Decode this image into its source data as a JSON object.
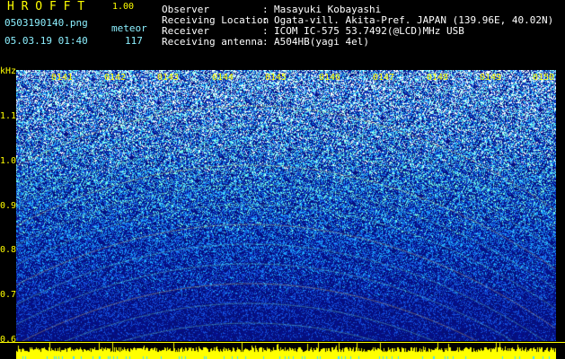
{
  "header": {
    "app_title": "H R O F F T",
    "app_version": "1.00",
    "file_name": "0503190140.png",
    "meteor_label": "meteor",
    "datetime": "05.03.19 01:40",
    "meteor_count": "117"
  },
  "info": [
    {
      "key": "Observer",
      "value": "Masayuki Kobayashi"
    },
    {
      "key": "Receiving Location",
      "value": "Ogata-vill. Akita-Pref. JAPAN (139.96E, 40.02N)"
    },
    {
      "key": "Receiver",
      "value": "ICOM IC-575 53.7492(@LCD)MHz USB"
    },
    {
      "key": "Receiving antenna",
      "value": "A504HB(yagi 4el)"
    }
  ],
  "info_separator": ":",
  "axis": {
    "y_unit": "kHz",
    "y_ticks": [
      "1.1",
      "1.0",
      "0.9",
      "0.8",
      "0.7",
      "0.6"
    ],
    "x_ticks": [
      "0141",
      "0142",
      "0143",
      "0144",
      "0145",
      "0146",
      "0147",
      "0148",
      "0149",
      "0150"
    ]
  },
  "colors": {
    "text_yellow": "#ffff00",
    "text_light_blue": "#8cf0ff",
    "text_white": "#ffffff",
    "background": "#000000",
    "waterfall_base": "#0a1a8c",
    "spectrum_bar": "#ffff00"
  }
}
